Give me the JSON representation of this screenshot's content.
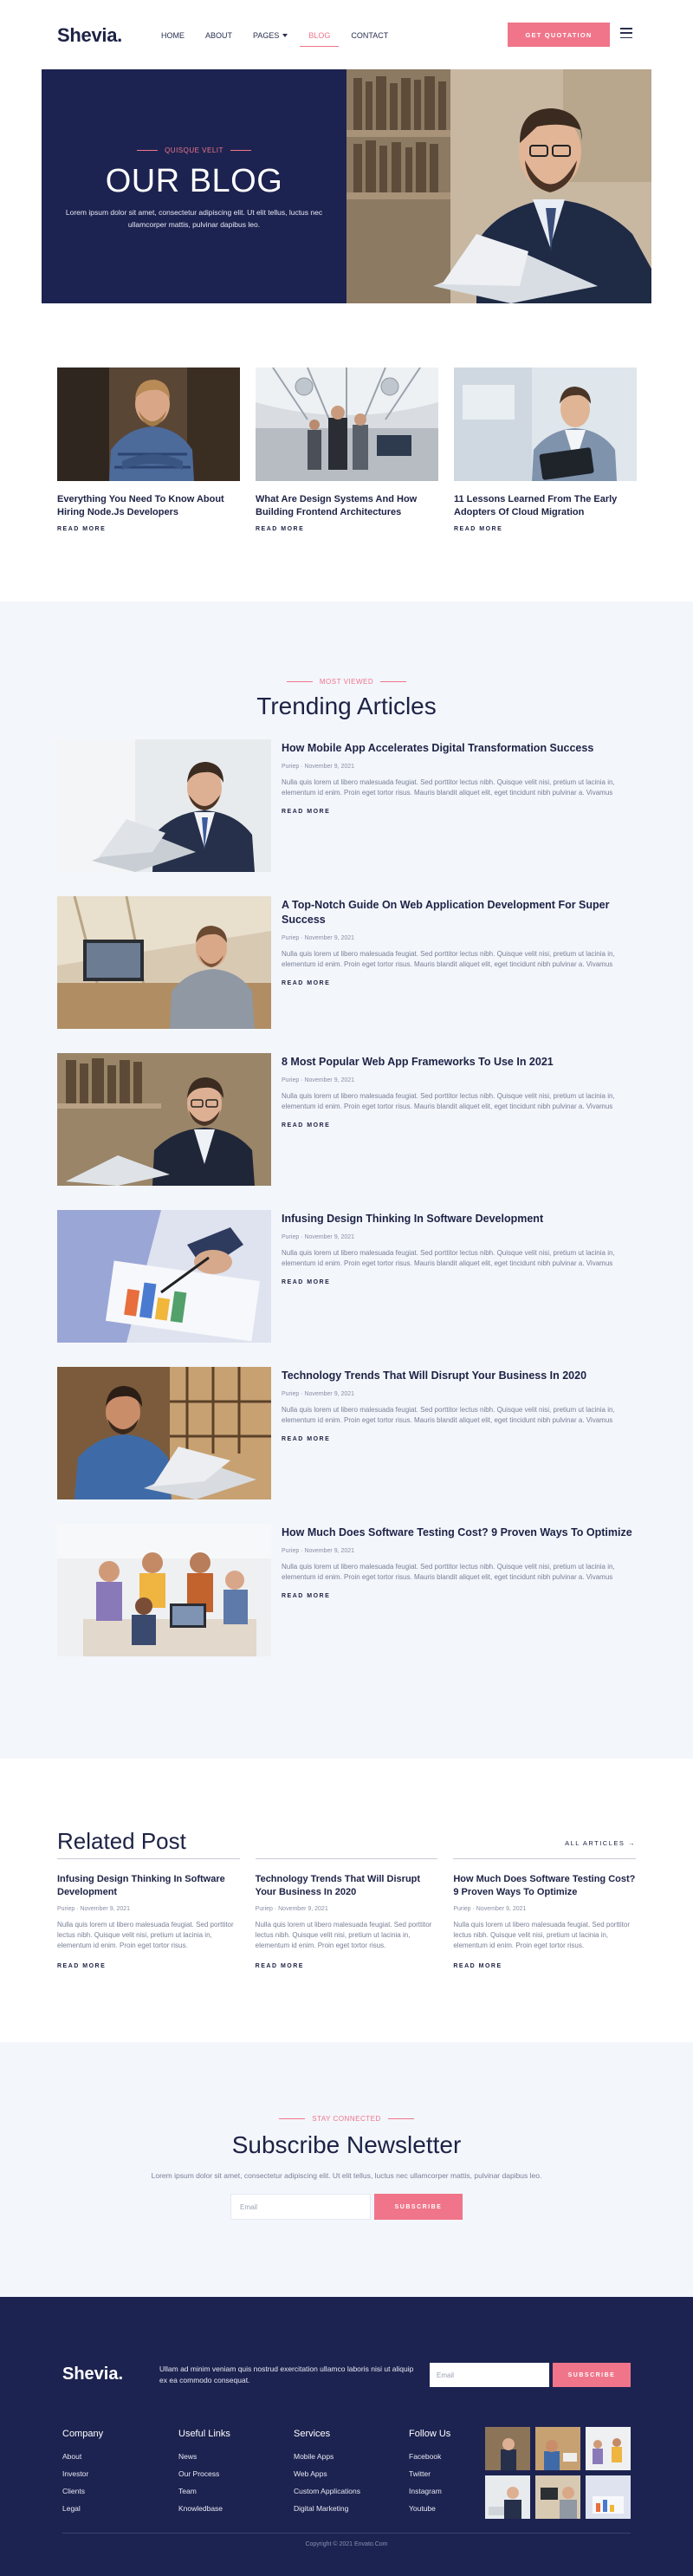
{
  "header": {
    "logo": "Shevia.",
    "nav": [
      "HOME",
      "ABOUT",
      "PAGES",
      "BLOG",
      "CONTACT"
    ],
    "active_nav": "BLOG",
    "cta": "GET QUOTATION"
  },
  "hero": {
    "eyebrow": "QUISQUE VELIT",
    "title": "OUR BLOG",
    "description": "Lorem ipsum dolor sit amet, consectetur adipiscing elit. Ut elit tellus, luctus nec ullamcorper mattis, pulvinar dapibus leo."
  },
  "featured": [
    {
      "title": "Everything You Need To Know About Hiring Node.Js Developers",
      "read_more": "READ MORE"
    },
    {
      "title": "What Are Design Systems And How Building Frontend Architectures",
      "read_more": "READ MORE"
    },
    {
      "title": "11 Lessons Learned From The Early Adopters Of Cloud Migration",
      "read_more": "READ MORE"
    }
  ],
  "trending": {
    "eyebrow": "MOST VIEWED",
    "title": "Trending Articles",
    "articles": [
      {
        "title": "How Mobile App Accelerates Digital Transformation Success",
        "meta": "Puriep · November 9, 2021",
        "text": "Nulla quis lorem ut libero malesuada feugiat. Sed porttitor lectus nibh. Quisque velit nisi, pretium ut lacinia in, elementum id enim. Proin eget tortor risus. Mauris blandit aliquet elit, eget tincidunt nibh pulvinar a. Vivamus",
        "read_more": "READ MORE"
      },
      {
        "title": "A Top-Notch Guide On Web Application Development For Super Success",
        "meta": "Puriep · November 9, 2021",
        "text": "Nulla quis lorem ut libero malesuada feugiat. Sed porttitor lectus nibh. Quisque velit nisi, pretium ut lacinia in, elementum id enim. Proin eget tortor risus. Mauris blandit aliquet elit, eget tincidunt nibh pulvinar a. Vivamus",
        "read_more": "READ MORE"
      },
      {
        "title": "8 Most Popular Web App Frameworks To Use In 2021",
        "meta": "Puriep · November 9, 2021",
        "text": "Nulla quis lorem ut libero malesuada feugiat. Sed porttitor lectus nibh. Quisque velit nisi, pretium ut lacinia in, elementum id enim. Proin eget tortor risus. Mauris blandit aliquet elit, eget tincidunt nibh pulvinar a. Vivamus",
        "read_more": "READ MORE"
      },
      {
        "title": "Infusing Design Thinking In Software Development",
        "meta": "Puriep · November 9, 2021",
        "text": "Nulla quis lorem ut libero malesuada feugiat. Sed porttitor lectus nibh. Quisque velit nisi, pretium ut lacinia in, elementum id enim. Proin eget tortor risus. Mauris blandit aliquet elit, eget tincidunt nibh pulvinar a. Vivamus",
        "read_more": "READ MORE"
      },
      {
        "title": "Technology Trends That Will Disrupt Your Business In 2020",
        "meta": "Puriep · November 9, 2021",
        "text": "Nulla quis lorem ut libero malesuada feugiat. Sed porttitor lectus nibh. Quisque velit nisi, pretium ut lacinia in, elementum id enim. Proin eget tortor risus. Mauris blandit aliquet elit, eget tincidunt nibh pulvinar a. Vivamus",
        "read_more": "READ MORE"
      },
      {
        "title": "How Much Does Software Testing Cost? 9 Proven Ways To Optimize",
        "meta": "Puriep · November 9, 2021",
        "text": "Nulla quis lorem ut libero malesuada feugiat. Sed porttitor lectus nibh. Quisque velit nisi, pretium ut lacinia in, elementum id enim. Proin eget tortor risus. Mauris blandit aliquet elit, eget tincidunt nibh pulvinar a. Vivamus",
        "read_more": "READ MORE"
      }
    ]
  },
  "related": {
    "title": "Related Post",
    "all_articles": "ALL ARTICLES →",
    "posts": [
      {
        "title": "Infusing Design Thinking In Software Development",
        "meta": "Puriep · November 9, 2021",
        "text": "Nulla quis lorem ut libero malesuada feugiat. Sed porttitor lectus nibh. Quisque velit nisi, pretium ut lacinia in, elementum id enim. Proin eget tortor risus.",
        "read_more": "READ MORE"
      },
      {
        "title": "Technology Trends That Will Disrupt Your Business In 2020",
        "meta": "Puriep · November 9, 2021",
        "text": "Nulla quis lorem ut libero malesuada feugiat. Sed porttitor lectus nibh. Quisque velit nisi, pretium ut lacinia in, elementum id enim. Proin eget tortor risus.",
        "read_more": "READ MORE"
      },
      {
        "title": "How Much Does Software Testing Cost? 9 Proven Ways To Optimize",
        "meta": "Puriep · November 9, 2021",
        "text": "Nulla quis lorem ut libero malesuada feugiat. Sed porttitor lectus nibh. Quisque velit nisi, pretium ut lacinia in, elementum id enim. Proin eget tortor risus.",
        "read_more": "READ MORE"
      }
    ]
  },
  "newsletter": {
    "eyebrow": "STAY CONNECTED",
    "title": "Subscribe Newsletter",
    "description": "Lorem ipsum dolor sit amet, consectetur adipiscing elit. Ut elit tellus, luctus nec ullamcorper mattis, pulvinar dapibus leo.",
    "placeholder": "Email",
    "button": "SUBSCRIBE"
  },
  "footer": {
    "logo": "Shevia.",
    "description": "Ullam ad minim veniam quis nostrud exercitation ullamco laboris nisi ut aliquip ex ea commodo consequat.",
    "placeholder": "Email",
    "button": "SUBSCRIBE",
    "columns": [
      {
        "title": "Company",
        "links": [
          "About",
          "Investor",
          "Clients",
          "Legal"
        ]
      },
      {
        "title": "Useful Links",
        "links": [
          "News",
          "Our Process",
          "Team",
          "Knowledbase"
        ]
      },
      {
        "title": "Services",
        "links": [
          "Mobile Apps",
          "Web Apps",
          "Custom Applications",
          "Digital Marketing"
        ]
      },
      {
        "title": "Follow Us",
        "links": [
          "Facebook",
          "Twitter",
          "Instagram",
          "Youtube"
        ]
      }
    ],
    "copyright": "Copyright © 2021 Envato.Com"
  },
  "colors": {
    "navy": "#1d2350",
    "accent": "#f0758a",
    "light_bg": "#f3f6fb"
  }
}
